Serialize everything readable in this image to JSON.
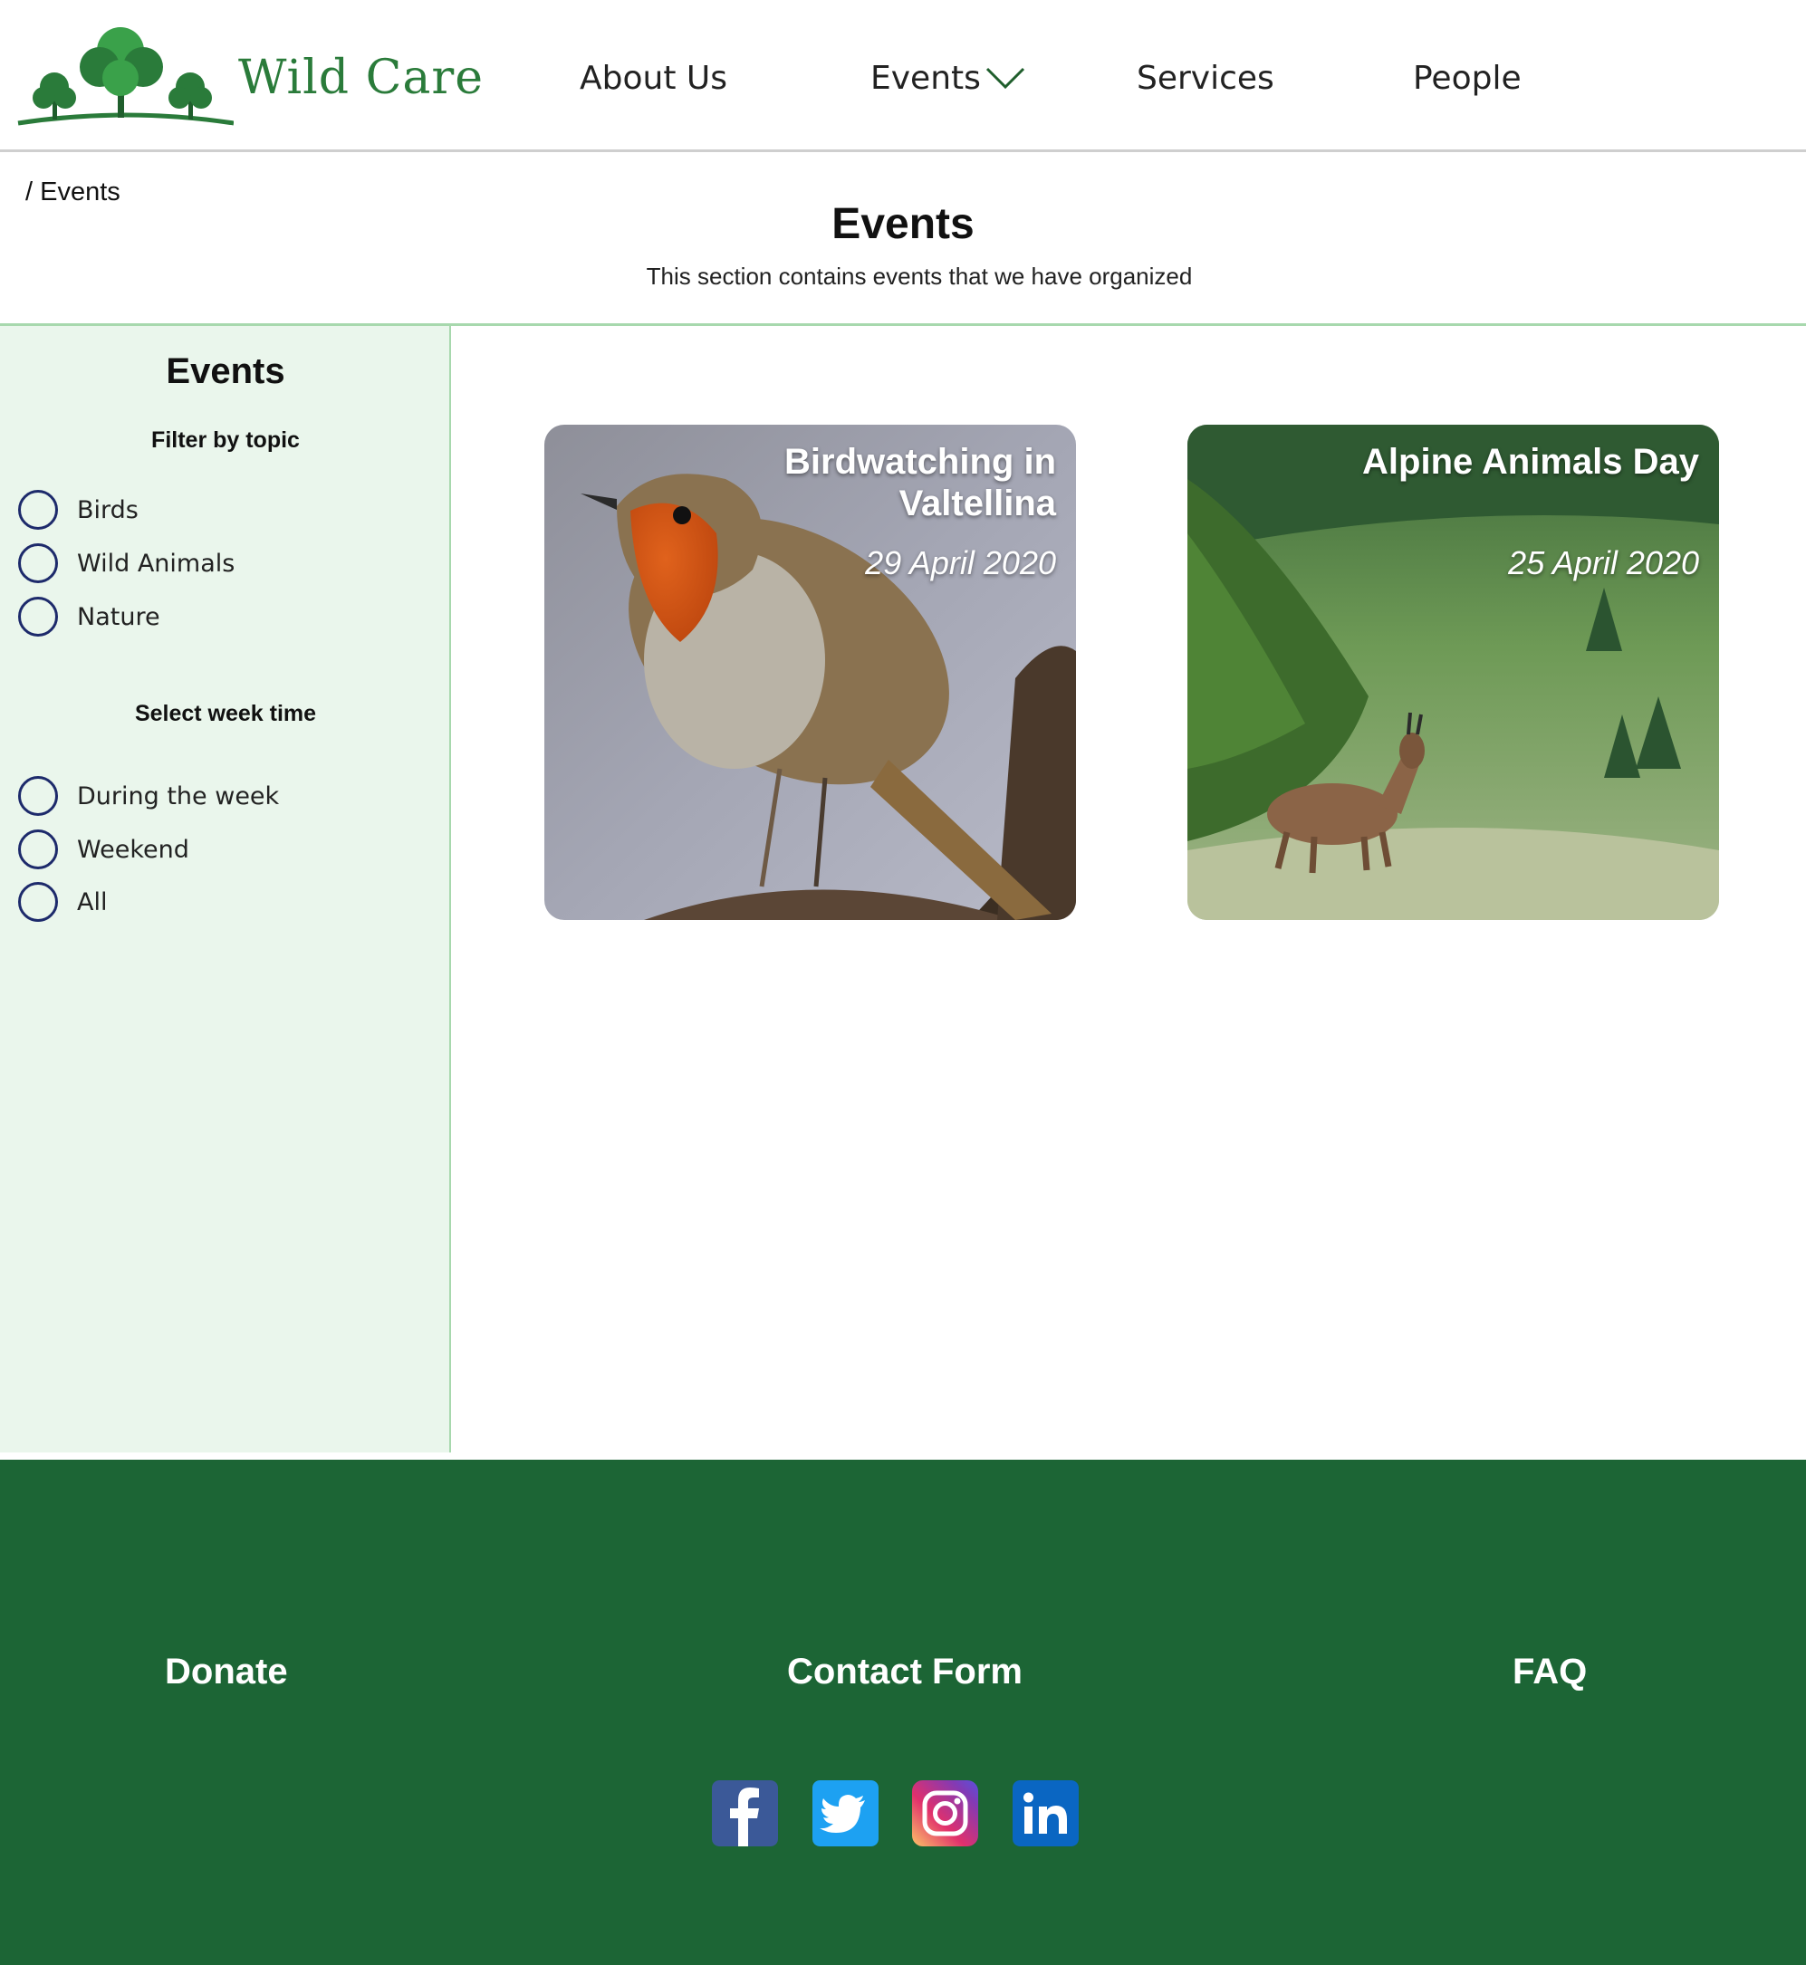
{
  "header": {
    "logo_text": "Wild Care",
    "nav": [
      {
        "label": "About Us"
      },
      {
        "label": "Events",
        "has_dropdown": true
      },
      {
        "label": "Services"
      },
      {
        "label": "People"
      }
    ]
  },
  "breadcrumb": "/ Events",
  "page": {
    "title": "Events",
    "subtitle": "This section contains events that we have organized"
  },
  "sidebar": {
    "title": "Events",
    "topic_heading": "Filter by topic",
    "topics": [
      "Birds",
      "Wild Animals",
      "Nature"
    ],
    "week_heading": "Select week time",
    "week_options": [
      "During the week",
      "Weekend",
      "All"
    ]
  },
  "events": [
    {
      "title": "Birdwatching in Valtellina",
      "date": "29 April 2020",
      "image_icon": "robin-photo"
    },
    {
      "title": "Alpine Animals Day",
      "date": "25 April 2020",
      "image_icon": "chamois-photo"
    }
  ],
  "footer": {
    "links": [
      "Donate",
      "Contact Form",
      "FAQ"
    ],
    "social": [
      {
        "name": "facebook-icon",
        "glyph": "f",
        "color": "#3b5998"
      },
      {
        "name": "twitter-icon",
        "glyph": "",
        "color": "#1da1f2"
      },
      {
        "name": "instagram-icon",
        "glyph": "",
        "color": "#d6249f"
      },
      {
        "name": "linkedin-icon",
        "glyph": "in",
        "color": "#0a66c2"
      }
    ]
  },
  "colors": {
    "brand_green": "#2a7b3a",
    "footer_green": "#1c6535",
    "sidebar_bg": "#eaf6ec",
    "divider_green": "#a7d8ad",
    "radio_border": "#1d2a6b"
  }
}
